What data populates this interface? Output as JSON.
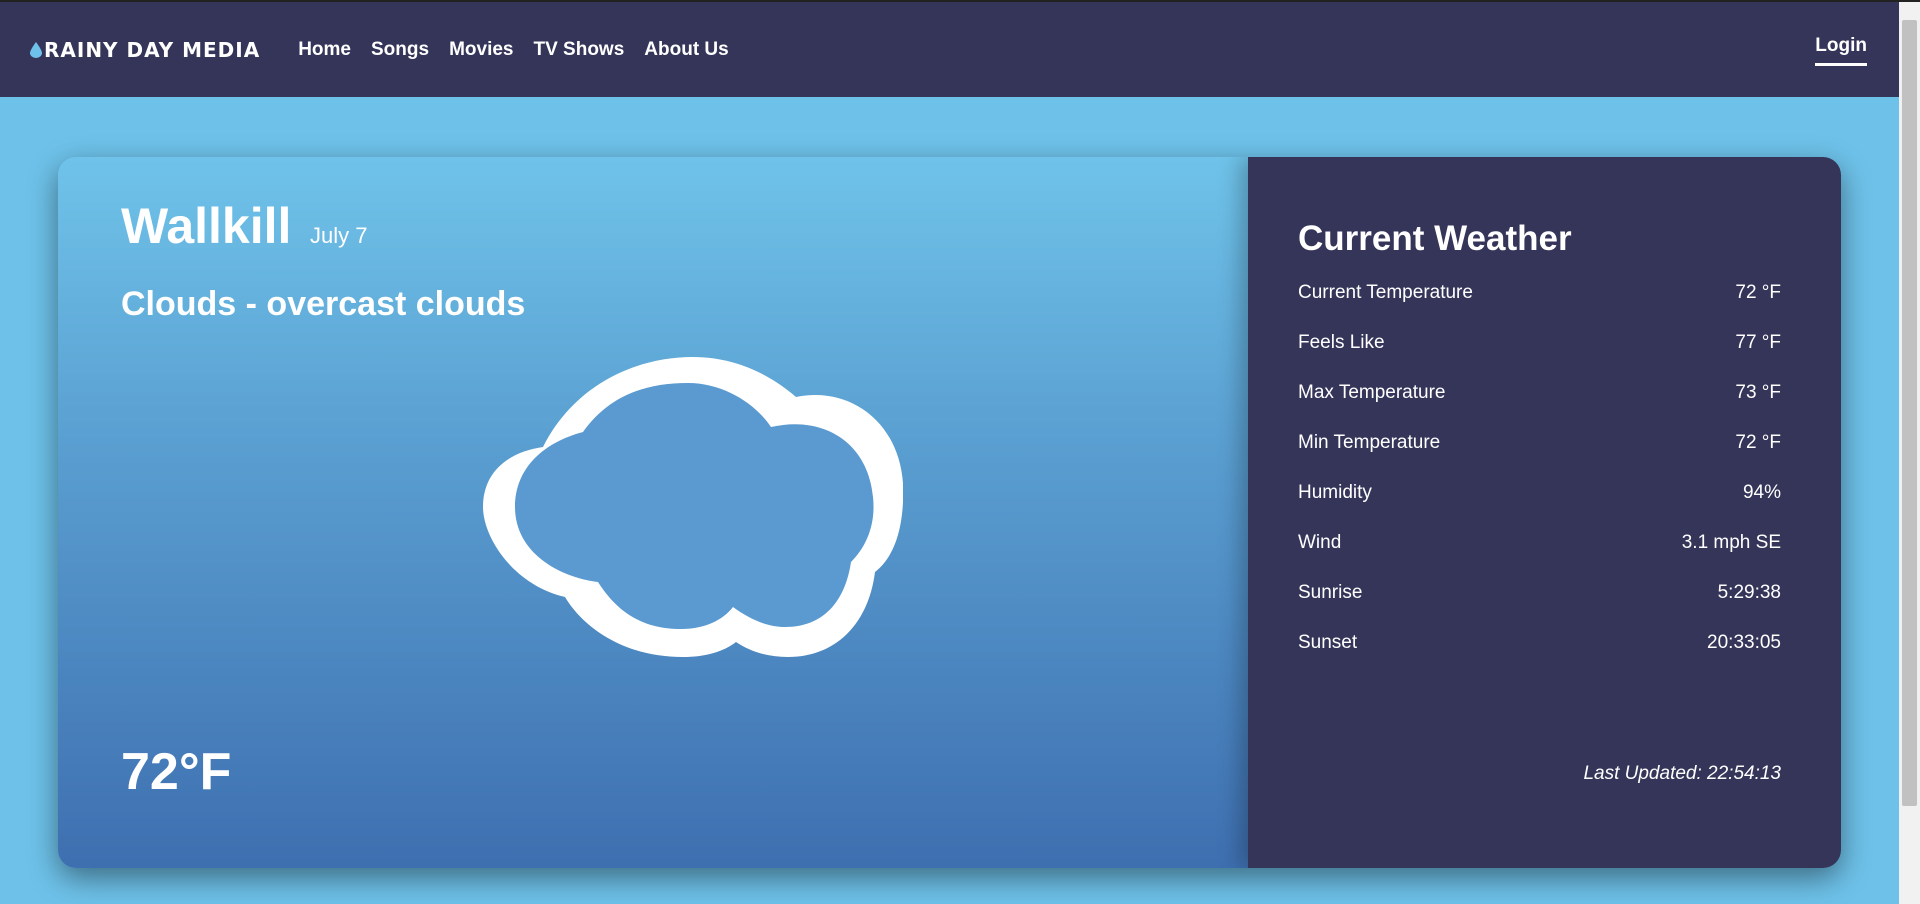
{
  "nav": {
    "brand": "Rainy Day Media",
    "links": [
      "Home",
      "Songs",
      "Movies",
      "TV Shows",
      "About Us"
    ],
    "login": "Login"
  },
  "weather": {
    "city": "Wallkill",
    "date": "July 7",
    "description": "Clouds - overcast clouds",
    "temperature": "72°F",
    "icon": "cloud-icon"
  },
  "current": {
    "title": "Current Weather",
    "rows": [
      {
        "label": "Current Temperature",
        "value": "72 °F"
      },
      {
        "label": "Feels Like",
        "value": "77 °F"
      },
      {
        "label": "Max Temperature",
        "value": "73 °F"
      },
      {
        "label": "Min Temperature",
        "value": "72 °F"
      },
      {
        "label": "Humidity",
        "value": "94%"
      },
      {
        "label": "Wind",
        "value": "3.1 mph SE"
      },
      {
        "label": "Sunrise",
        "value": "5:29:38"
      },
      {
        "label": "Sunset",
        "value": "20:33:05"
      }
    ],
    "last_updated": "Last Updated: 22:54:13"
  },
  "colors": {
    "navbar": "#35355a",
    "page_bg": "#6ec2ea",
    "panel_dark": "#35355a",
    "gradient_top": "#6fc3ea",
    "gradient_bottom": "#3e6fb0"
  }
}
